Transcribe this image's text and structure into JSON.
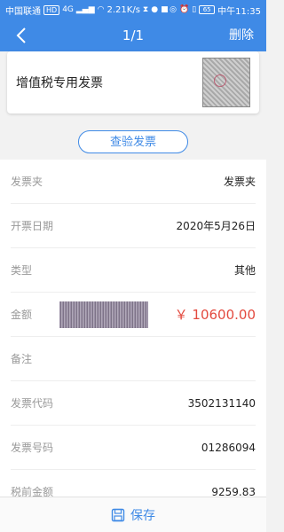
{
  "status_bar": {
    "carrier": "中国联通",
    "hd_badge": "HD",
    "signal_type": "4G",
    "speed": "2.21K/s",
    "battery": "65",
    "time": "中午11:35"
  },
  "nav": {
    "title": "1/1",
    "delete_label": "删除"
  },
  "invoice": {
    "type": "增值税专用发票"
  },
  "check_button": "查验发票",
  "details": [
    {
      "label": "发票夹",
      "value": "发票夹"
    },
    {
      "label": "开票日期",
      "value": "2020年5月26日"
    },
    {
      "label": "类型",
      "value": "其他"
    },
    {
      "label": "金额",
      "value": "￥ 10600.00"
    },
    {
      "label": "备注",
      "value": ""
    },
    {
      "label": "发票代码",
      "value": "3502131140"
    },
    {
      "label": "发票号码",
      "value": "01286094"
    },
    {
      "label": "税前金额",
      "value": "9259.83"
    }
  ],
  "save_label": "保存",
  "colors": {
    "primary": "#3f8ae6",
    "amount": "#e34a3f"
  }
}
